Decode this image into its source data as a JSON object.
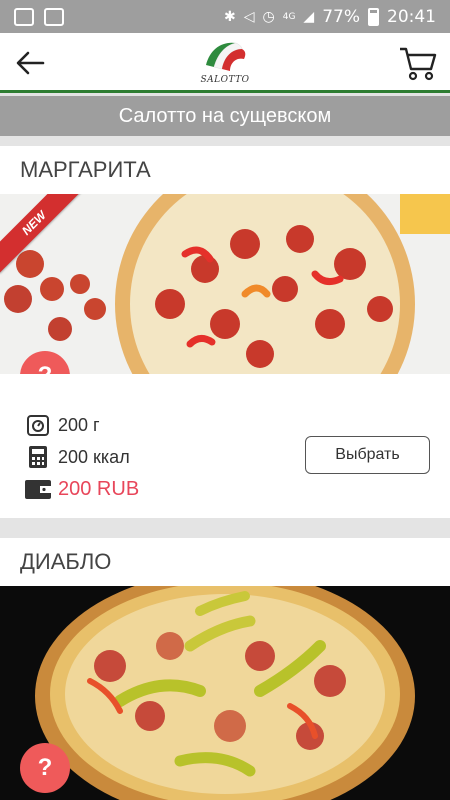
{
  "status_bar": {
    "battery": "77%",
    "time": "20:41",
    "network": "4G"
  },
  "app_bar": {
    "logo_text": "SALOTTO"
  },
  "location_title": "Салотто на сущевском",
  "products": [
    {
      "name": "МАРГАРИТА",
      "badge": "NEW",
      "help": "?",
      "weight": "200 г",
      "calories": "200 ккал",
      "price": "200 RUB",
      "select_label": "Выбрать"
    },
    {
      "name": "ДИАБЛО",
      "help": "?"
    }
  ],
  "colors": {
    "accent_green": "#2e7d32",
    "price_red": "#e8465a",
    "help_button": "#ef5a5a",
    "header_gray": "#9e9e9e"
  }
}
